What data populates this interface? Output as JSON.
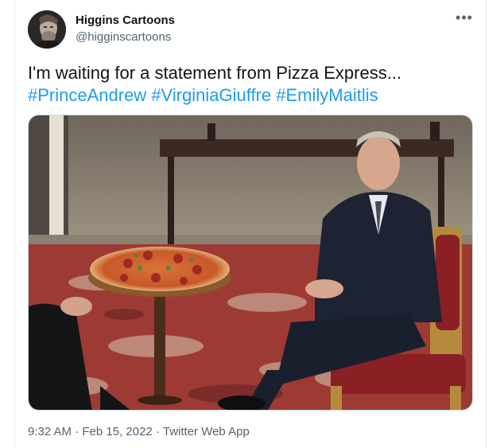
{
  "author": {
    "display_name": "Higgins Cartoons",
    "handle": "@higginscartoons"
  },
  "more_icon": "more-horizontal-icon",
  "tweet": {
    "text": "I'm waiting for a statement from Pizza Express...",
    "hashtags": [
      "#PrinceAndrew",
      "#VirginiaGiuffre",
      "#EmilyMaitlis"
    ]
  },
  "footer": {
    "time": "9:32 AM",
    "separator": " · ",
    "date": "Feb 15, 2022",
    "source": "Twitter Web App"
  },
  "colors": {
    "link": "#1d9bf0",
    "secondary_text": "#536471",
    "border": "#e6ecf0"
  }
}
